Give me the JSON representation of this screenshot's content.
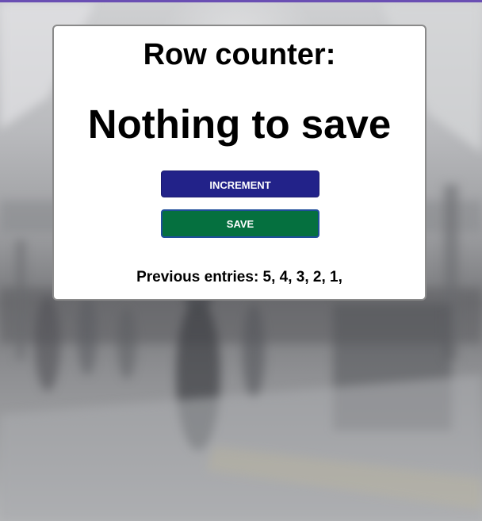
{
  "card": {
    "heading": "Row counter:",
    "status_message": "Nothing to save",
    "increment_label": "INCREMENT",
    "save_label": "SAVE",
    "entries_label": "Previous entries: 5, 4, 3, 2, 1,"
  },
  "colors": {
    "increment_button": "#222289",
    "save_button": "#05703f",
    "save_button_border": "#1f4e9a",
    "top_stripe": "#6a4fb3"
  }
}
